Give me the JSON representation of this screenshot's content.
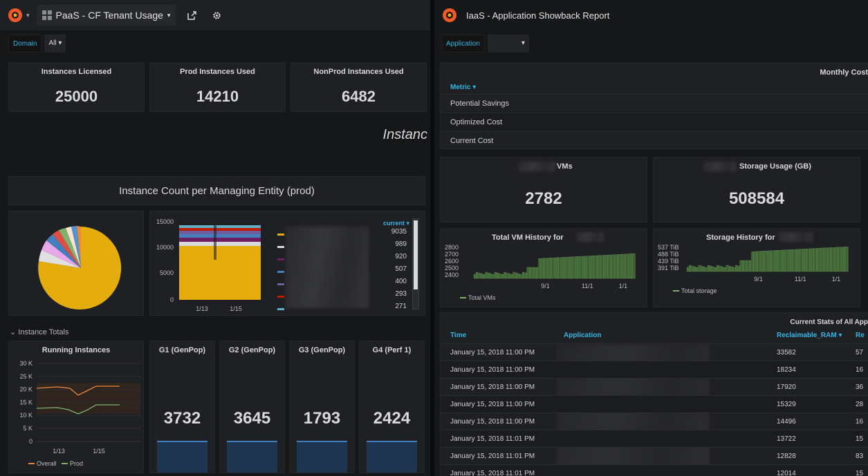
{
  "left": {
    "title": "PaaS - CF Tenant Usage",
    "var": {
      "label": "Domain",
      "value": "All"
    },
    "stats": [
      {
        "title": "Instances Licensed",
        "value": "25000"
      },
      {
        "title": "Prod Instances Used",
        "value": "14210"
      },
      {
        "title": "NonProd Instances Used",
        "value": "6482"
      }
    ],
    "banner_text": "Instanc",
    "entity_title": "Instance Count per Managing Entity (prod)",
    "bar_axis": {
      "y": [
        "15000",
        "10000",
        "5000",
        "0"
      ],
      "x": [
        "1/13",
        "1/15"
      ]
    },
    "legend": {
      "header": "current",
      "values": [
        "9035",
        "989",
        "920",
        "507",
        "400",
        "293",
        "271"
      ],
      "colors": [
        "#e5ac0e",
        "#d8d9da",
        "#6d1f62",
        "#447ebc",
        "#705da0",
        "#bf1b00",
        "#64b0c8"
      ]
    },
    "row_title": "Instance Totals",
    "running": {
      "title": "Running Instances",
      "y": [
        "30 K",
        "25 K",
        "20 K",
        "15 K",
        "10 K",
        "5 K",
        "0"
      ],
      "x": [
        "1/13",
        "1/15"
      ],
      "legend": [
        "Overall",
        "Prod"
      ],
      "colors": [
        "#ef843c",
        "#7eb26d"
      ]
    },
    "groups": [
      {
        "title": "G1 (GenPop)",
        "value": "3732"
      },
      {
        "title": "G2 (GenPop)",
        "value": "3645"
      },
      {
        "title": "G3 (GenPop)",
        "value": "1793"
      },
      {
        "title": "G4 (Perf 1)",
        "value": "2424"
      }
    ]
  },
  "right": {
    "title": "IaaS - Application Showback Report",
    "var": {
      "label": "Application"
    },
    "monthly": {
      "title": "Monthly Cost",
      "header": "Metric",
      "rows": [
        "Potential Savings",
        "Optimized Cost",
        "Current Cost"
      ]
    },
    "vms": {
      "title": "VMs",
      "value": "2782"
    },
    "storage": {
      "title": "Storage Usage (GB)",
      "value": "508584"
    },
    "vm_hist": {
      "title": "Total VM History for",
      "y": [
        "2800",
        "2700",
        "2600",
        "2500",
        "2400"
      ],
      "x": [
        "9/1",
        "11/1",
        "1/1"
      ],
      "legend": "Total VMs"
    },
    "st_hist": {
      "title": "Storage History for",
      "y": [
        "537 TiB",
        "488 TiB",
        "439 TiB",
        "391 TiB"
      ],
      "x": [
        "9/1",
        "11/1",
        "1/1"
      ],
      "legend": "Total storage"
    },
    "stats_table": {
      "title": "Current Stats of All App",
      "columns": [
        "Time",
        "Application",
        "Reclaimable_RAM",
        "Re"
      ],
      "rows": [
        {
          "time": "January 15, 2018 11:00 PM",
          "ram": "33582",
          "re": "57"
        },
        {
          "time": "January 15, 2018 11:00 PM",
          "ram": "18234",
          "re": "16"
        },
        {
          "time": "January 15, 2018 11:00 PM",
          "ram": "17920",
          "re": "36"
        },
        {
          "time": "January 15, 2018 11:00 PM",
          "ram": "15329",
          "re": "28"
        },
        {
          "time": "January 15, 2018 11:00 PM",
          "ram": "14496",
          "re": "16"
        },
        {
          "time": "January 15, 2018 11:01 PM",
          "ram": "13722",
          "re": "15"
        },
        {
          "time": "January 15, 2018 11:01 PM",
          "ram": "12828",
          "re": "83"
        },
        {
          "time": "January 15, 2018 11:01 PM",
          "ram": "12014",
          "re": "15"
        }
      ]
    }
  }
}
